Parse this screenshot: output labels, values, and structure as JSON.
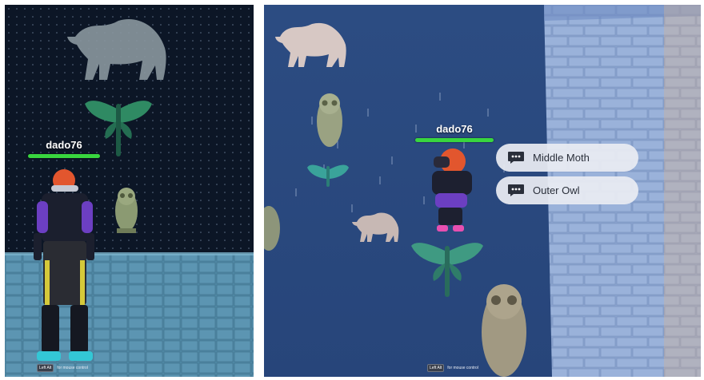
{
  "left_view": {
    "player_name": "dado76",
    "hint": {
      "key": "Left Alt",
      "text": "for mouse control"
    }
  },
  "right_view": {
    "player_name": "dado76",
    "hint": {
      "key": "Left Alt",
      "text": "for mouse control"
    },
    "dialog_options": [
      {
        "label": "Middle Moth",
        "icon": "chat-bubble-icon"
      },
      {
        "label": "Outer Owl",
        "icon": "chat-bubble-icon"
      }
    ]
  },
  "colors": {
    "health_bar": "#39d63f",
    "left_backdrop": "#0b1424",
    "right_backdrop": "#2e4f86",
    "option_bubble": "#e9ecf2"
  }
}
